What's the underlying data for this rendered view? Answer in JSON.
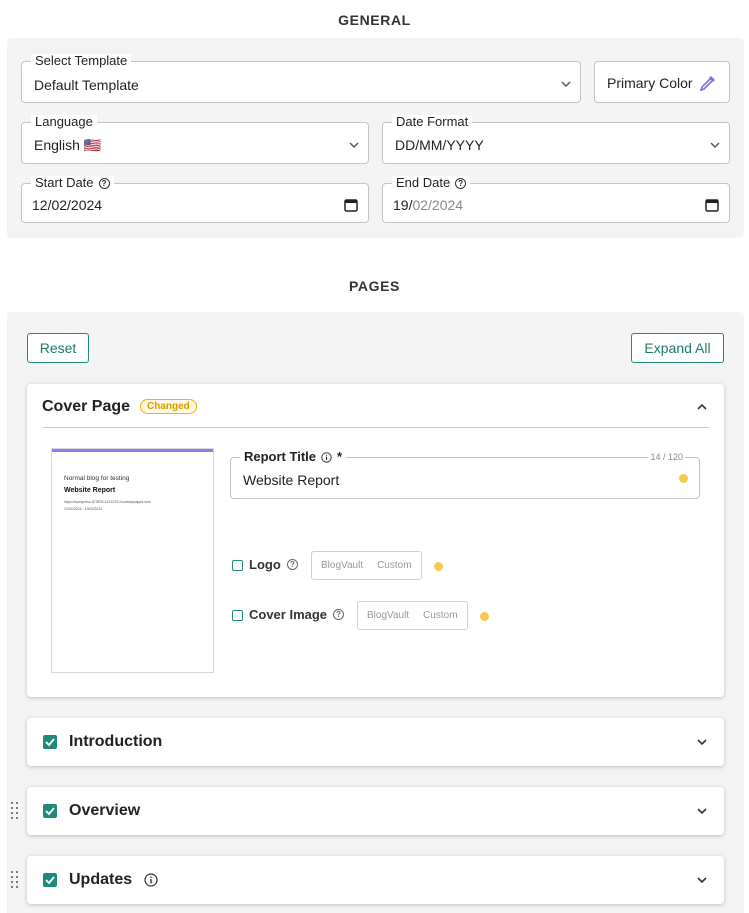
{
  "general": {
    "heading": "GENERAL",
    "template": {
      "label": "Select Template",
      "value": "Default Template"
    },
    "primary_color": {
      "label": "Primary Color",
      "icon": "eyedropper-icon",
      "color": "#7b6ff0"
    },
    "language": {
      "label": "Language",
      "value": "English 🇺🇸"
    },
    "date_format": {
      "label": "Date Format",
      "value": "DD/MM/YYYY"
    },
    "start_date": {
      "label": "Start Date",
      "value": "12/02/2024"
    },
    "end_date": {
      "label": "End Date",
      "value_day": "19/",
      "value_rest": "02/2024"
    }
  },
  "pages": {
    "heading": "PAGES",
    "reset_label": "Reset",
    "expand_all_label": "Expand All",
    "cover_page": {
      "title": "Cover Page",
      "badge": "Changed",
      "preview": {
        "line1": "Normal blog for testing",
        "line2": "Website Report",
        "line3": "https://wordpress-873876-4213270.cloudwaysapps.com",
        "line4": "12/02/2024 - 19/02/2024"
      },
      "report_title": {
        "label": "Report Title",
        "required_mark": "*",
        "counter": "14 / 120",
        "value": "Website Report"
      },
      "logo": {
        "label": "Logo",
        "options": [
          "BlogVault",
          "Custom"
        ]
      },
      "cover_image": {
        "label": "Cover Image",
        "options": [
          "BlogVault",
          "Custom"
        ]
      }
    },
    "sections": [
      {
        "title": "Introduction"
      },
      {
        "title": "Overview"
      },
      {
        "title": "Updates"
      }
    ]
  },
  "colors": {
    "accent": "#1f8a7a",
    "brand_purple": "#8a7ff0",
    "changed_badge": "#f0b400",
    "status_dot": "#f6c94e"
  }
}
